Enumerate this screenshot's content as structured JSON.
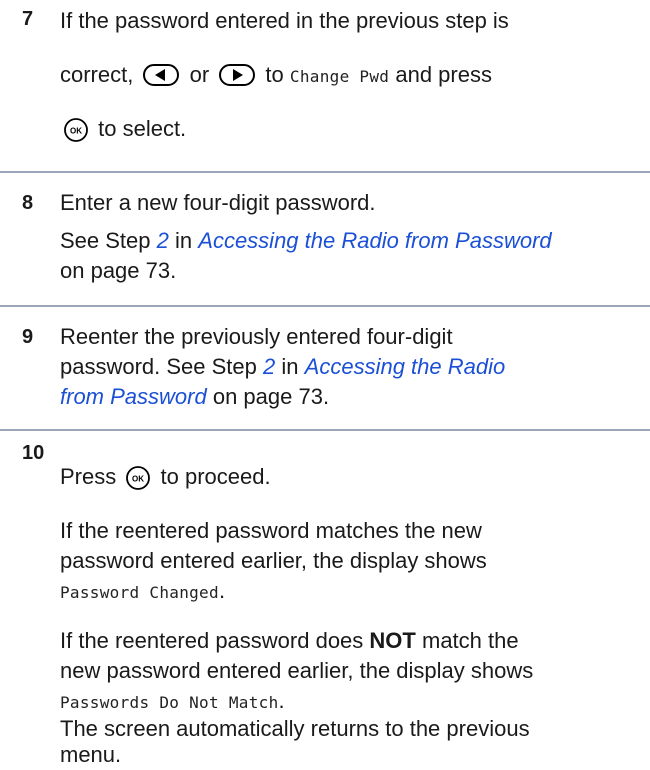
{
  "steps": [
    {
      "number": "7",
      "line1": "If the password entered in the previous step is",
      "line2_a": "correct,",
      "line2_b": "or",
      "line2_c": "to",
      "line2_mono": "Change Pwd",
      "line2_d": "and press",
      "line3": "to select."
    },
    {
      "number": "8",
      "line1": "Enter a new four-digit password.",
      "line2_a": "See Step",
      "line2_stepref": "2",
      "line2_b": "in",
      "line2_link": "Accessing the Radio from Password",
      "line3": "on page 73."
    },
    {
      "number": "9",
      "line1": "Reenter the previously entered four-digit",
      "line2_a": "password. See Step",
      "line2_stepref": "2",
      "line2_b": "in",
      "line2_link": "Accessing the Radio",
      "line3_link": "from Password",
      "line3_b": "on page 73."
    },
    {
      "number": "10",
      "line1_a": "Press",
      "line1_b": "to proceed.",
      "p1_line1": "If the reentered password matches the new",
      "p1_line2": "password entered earlier, the display shows",
      "p1_mono": "Password Changed",
      "p1_end": ".",
      "p2_line1_a": "If the reentered password does",
      "p2_bold": "NOT",
      "p2_line1_b": "match the",
      "p2_line2": "new password entered earlier, the display shows",
      "p2_mono": "Passwords Do Not Match",
      "p2_end": ".",
      "p3_line1": "The screen automatically returns to the previous",
      "p3_line2": "menu."
    }
  ],
  "icons": {
    "left": "left-arrow-button-icon",
    "right": "right-arrow-button-icon",
    "ok": "ok-button-icon",
    "ok_label": "OK"
  }
}
